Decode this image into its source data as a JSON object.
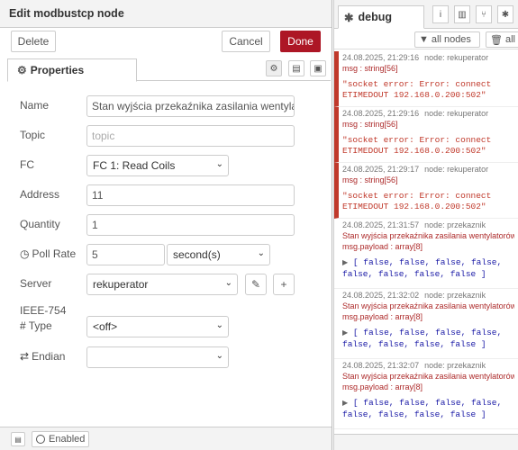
{
  "editor": {
    "title": "Edit modbustcp node",
    "delete_label": "Delete",
    "cancel_label": "Cancel",
    "done_label": "Done",
    "tab_properties": "Properties",
    "enabled_label": "Enabled"
  },
  "form": {
    "name_label": "Name",
    "name_value": "Stan wyjścia przekaźnika zasilania wentylatorów",
    "topic_label": "Topic",
    "topic_placeholder": "topic",
    "fc_label": "FC",
    "fc_value": "FC 1: Read Coils",
    "address_label": "Address",
    "address_value": "11",
    "quantity_label": "Quantity",
    "quantity_value": "1",
    "poll_label": "Poll Rate",
    "poll_value": "5",
    "poll_unit": "second(s)",
    "server_label": "Server",
    "server_value": "rekuperator",
    "ieee_label": "IEEE-754",
    "type_label": "Type",
    "type_value": "<off>",
    "endian_label": "Endian",
    "endian_value": ""
  },
  "sidebar": {
    "tab_debug": "debug",
    "filter_nodes": "all nodes",
    "filter_all": "all",
    "messages": [
      {
        "time": "24.08.2025, 21:29:16",
        "node": "node: rekuperator",
        "sub": "msg : string[56]",
        "body": "\"socket error: Error: connect ETIMEDOUT 192.168.0.200:502\""
      },
      {
        "time": "24.08.2025, 21:29:16",
        "node": "node: rekuperator",
        "sub": "msg : string[56]",
        "body": "\"socket error: Error: connect ETIMEDOUT 192.168.0.200:502\""
      },
      {
        "time": "24.08.2025, 21:29:17",
        "node": "node: rekuperator",
        "sub": "msg : string[56]",
        "body": "\"socket error: Error: connect ETIMEDOUT 192.168.0.200:502\""
      },
      {
        "time": "24.08.2025, 21:31:57",
        "node": "node: przekaznik",
        "sub": "Stan wyjścia przekaźnika zasilania wentylatorów :",
        "sub2": "msg.payload : array[8]",
        "line1": "[ false, false, false, false,",
        "line2": "false, false, false, false ]"
      },
      {
        "time": "24.08.2025, 21:32:02",
        "node": "node: przekaznik",
        "sub": "Stan wyjścia przekaźnika zasilania wentylatorów :",
        "sub2": "msg.payload : array[8]",
        "line1": "[ false, false, false, false,",
        "line2": "false, false, false, false ]"
      },
      {
        "time": "24.08.2025, 21:32:07",
        "node": "node: przekaznik",
        "sub": "Stan wyjścia przekaźnika zasilania wentylatorów :",
        "sub2": "msg.payload : array[8]",
        "line1": "[ false, false, false, false,",
        "line2": "false, false, false, false ]"
      }
    ]
  }
}
